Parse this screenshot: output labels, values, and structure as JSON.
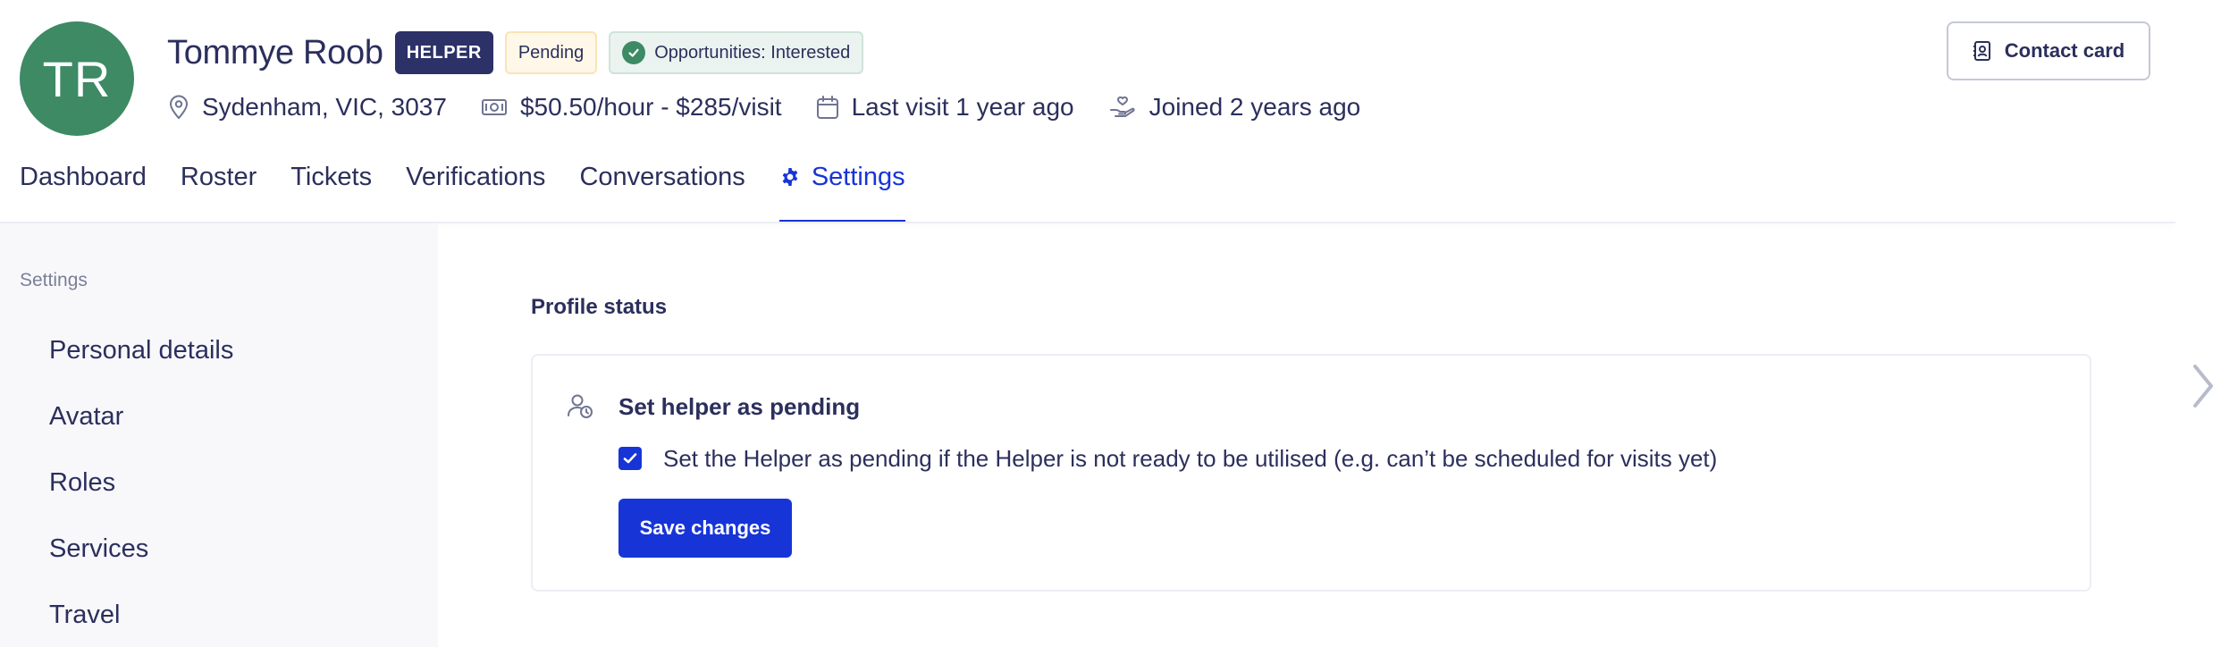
{
  "profile": {
    "initials": "TR",
    "name": "Tommye Roob",
    "role_badge": "HELPER",
    "status_badge": "Pending",
    "opportunities_badge": "Opportunities: Interested",
    "location": "Sydenham, VIC, 3037",
    "rate": "$50.50/hour - $285/visit",
    "last_visit": "Last visit 1 year ago",
    "joined": "Joined 2 years ago",
    "contact_card_label": "Contact card",
    "avatar_color": "#3d8a65"
  },
  "tabs": [
    {
      "label": "Dashboard",
      "active": false
    },
    {
      "label": "Roster",
      "active": false
    },
    {
      "label": "Tickets",
      "active": false
    },
    {
      "label": "Verifications",
      "active": false
    },
    {
      "label": "Conversations",
      "active": false
    },
    {
      "label": "Settings",
      "active": true
    }
  ],
  "sidebar": {
    "title": "Settings",
    "items": [
      {
        "label": "Personal details"
      },
      {
        "label": "Avatar"
      },
      {
        "label": "Roles"
      },
      {
        "label": "Services"
      },
      {
        "label": "Travel"
      }
    ]
  },
  "main": {
    "section_title": "Profile status",
    "card": {
      "title": "Set helper as pending",
      "checkbox_label": "Set the Helper as pending if the Helper is not ready to be utilised (e.g. can’t be scheduled for visits yet)",
      "checkbox_checked": true,
      "save_label": "Save changes"
    }
  },
  "colors": {
    "accent": "#1735d6",
    "text": "#2b2f5c",
    "role_badge_bg": "#2c3168"
  }
}
